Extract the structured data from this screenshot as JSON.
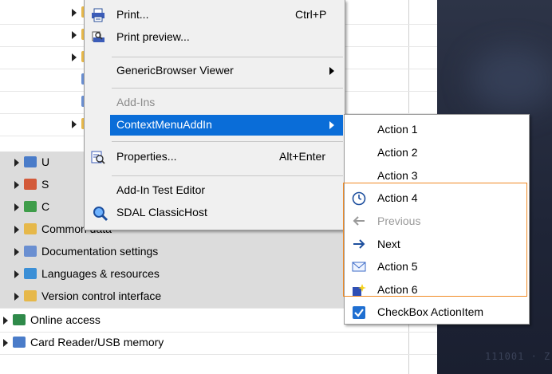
{
  "tree": {
    "rows": [
      {
        "label": "",
        "icon": "folder-icon",
        "indent": 90,
        "expander": true,
        "gray": false
      },
      {
        "label": "",
        "icon": "folder-icon",
        "indent": 90,
        "expander": true,
        "gray": false
      },
      {
        "label": "",
        "icon": "folder-icon",
        "indent": 90,
        "expander": true,
        "gray": false
      },
      {
        "label": "",
        "icon": "document-icon",
        "indent": 90,
        "expander": false,
        "gray": false
      },
      {
        "label": "",
        "icon": "document-icon",
        "indent": 90,
        "expander": false,
        "gray": false
      },
      {
        "label": "",
        "icon": "folder-icon",
        "indent": 90,
        "expander": true,
        "gray": false
      },
      {
        "label": "U",
        "icon": "device-icon",
        "indent": 18,
        "expander": true,
        "gray": true
      },
      {
        "label": "S",
        "icon": "network-icon",
        "indent": 18,
        "expander": true,
        "gray": true
      },
      {
        "label": "C",
        "icon": "cross-reference-icon",
        "indent": 18,
        "expander": true,
        "gray": true
      },
      {
        "label": "Common data",
        "icon": "common-data-icon",
        "indent": 18,
        "expander": true,
        "gray": true
      },
      {
        "label": "Documentation settings",
        "icon": "documentation-icon",
        "indent": 18,
        "expander": true,
        "gray": true
      },
      {
        "label": "Languages & resources",
        "icon": "languages-icon",
        "indent": 18,
        "expander": true,
        "gray": true
      },
      {
        "label": "Version control interface",
        "icon": "version-control-icon",
        "indent": 18,
        "expander": true,
        "gray": true
      },
      {
        "label": "Online access",
        "icon": "online-access-icon",
        "indent": 4,
        "expander": true,
        "gray": false
      },
      {
        "label": "Card Reader/USB memory",
        "icon": "card-reader-icon",
        "indent": 4,
        "expander": true,
        "gray": false
      }
    ]
  },
  "bg_faint_text": "111001 · Z",
  "menu": {
    "print": {
      "label": "Print...",
      "shortcut": "Ctrl+P"
    },
    "print_preview": {
      "label": "Print preview..."
    },
    "generic_browser": {
      "label": "GenericBrowser Viewer"
    },
    "addins_header": {
      "label": "Add-Ins"
    },
    "context_menu_addin": {
      "label": "ContextMenuAddIn"
    },
    "properties": {
      "label": "Properties...",
      "shortcut": "Alt+Enter"
    },
    "addin_test_editor": {
      "label": "Add-In Test Editor"
    },
    "sdal_classichost": {
      "label": "SDAL ClassicHost"
    }
  },
  "submenu": {
    "items": [
      {
        "label": "Action 1",
        "icon": "",
        "disabled": false
      },
      {
        "label": "Action 2",
        "icon": "",
        "disabled": false
      },
      {
        "label": "Action 3",
        "icon": "",
        "disabled": false
      },
      {
        "label": "Action 4",
        "icon": "clock-icon",
        "disabled": false
      },
      {
        "label": "Previous",
        "icon": "arrow-left-icon",
        "disabled": true
      },
      {
        "label": "Next",
        "icon": "arrow-right-icon",
        "disabled": false
      },
      {
        "label": "Action 5",
        "icon": "envelope-icon",
        "disabled": false
      },
      {
        "label": "Action 6",
        "icon": "sparkle-icon",
        "disabled": false
      },
      {
        "label": "CheckBox ActionItem",
        "icon": "checkbox-checked-icon",
        "disabled": false
      }
    ]
  },
  "colors": {
    "highlight": "#0a6dd8",
    "group_outline": "#f08a24",
    "dark_panel": "#1f2537"
  }
}
